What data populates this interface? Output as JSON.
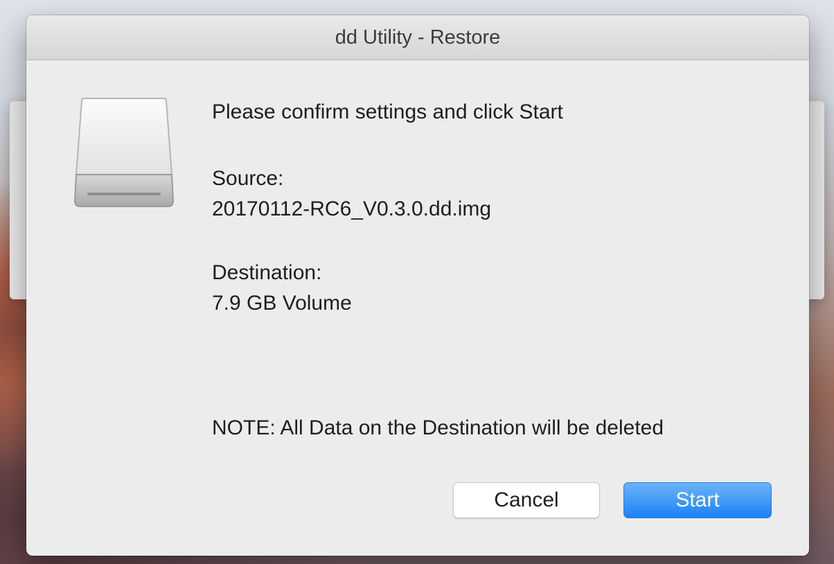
{
  "window": {
    "title": "dd Utility - Restore"
  },
  "icon": {
    "name": "external-drive-icon"
  },
  "message": {
    "prompt": "Please confirm settings and click Start",
    "source_label": "Source:",
    "source_value": "20170112-RC6_V0.3.0.dd.img",
    "destination_label": "Destination:",
    "destination_value": "7.9 GB Volume",
    "note": "NOTE: All Data on the Destination will be deleted"
  },
  "buttons": {
    "cancel_label": "Cancel",
    "start_label": "Start"
  },
  "colors": {
    "accent": "#1b82f5",
    "dialog_background": "#ececec"
  }
}
